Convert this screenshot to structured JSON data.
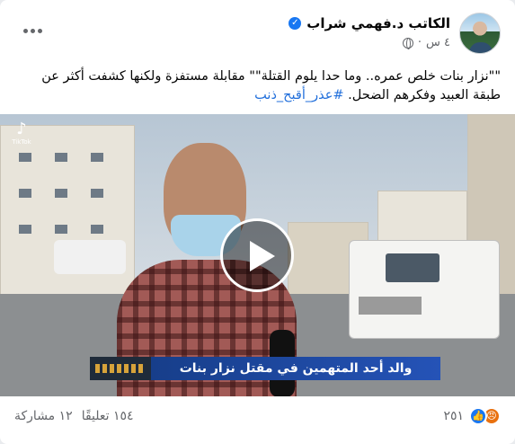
{
  "post": {
    "author": "الكاتب د.فهمي شراب",
    "time": "٤ س",
    "separator": "·",
    "text_main": "\"\"نزار بنات خلص عمره.. وما حدا يلوم القتلة\"\" مقابلة مستفزة ولكنها كشفت أكثر عن طبقة العبيد وفكرهم الضحل. ",
    "hashtag": "#عذر_أقبح_ذنب"
  },
  "video": {
    "watermark": "♪",
    "watermark_sub": "TikTok",
    "caption": "والد أحد المتهمين في مقتل نزار بنات"
  },
  "footer": {
    "reaction_count": "٢٥١",
    "comments": "١٥٤ تعليقًا",
    "shares": "١٢ مشاركة"
  },
  "icons": {
    "more": "more-options-icon",
    "privacy": "globe-icon",
    "verified": "verified-badge-icon",
    "play": "play-icon",
    "like": "like-reaction-icon",
    "angry": "angry-reaction-icon"
  },
  "colors": {
    "accent": "#1877f2",
    "hashtag": "#216fdb",
    "angry": "#e9710f",
    "caption_bar": "#2553b7"
  }
}
